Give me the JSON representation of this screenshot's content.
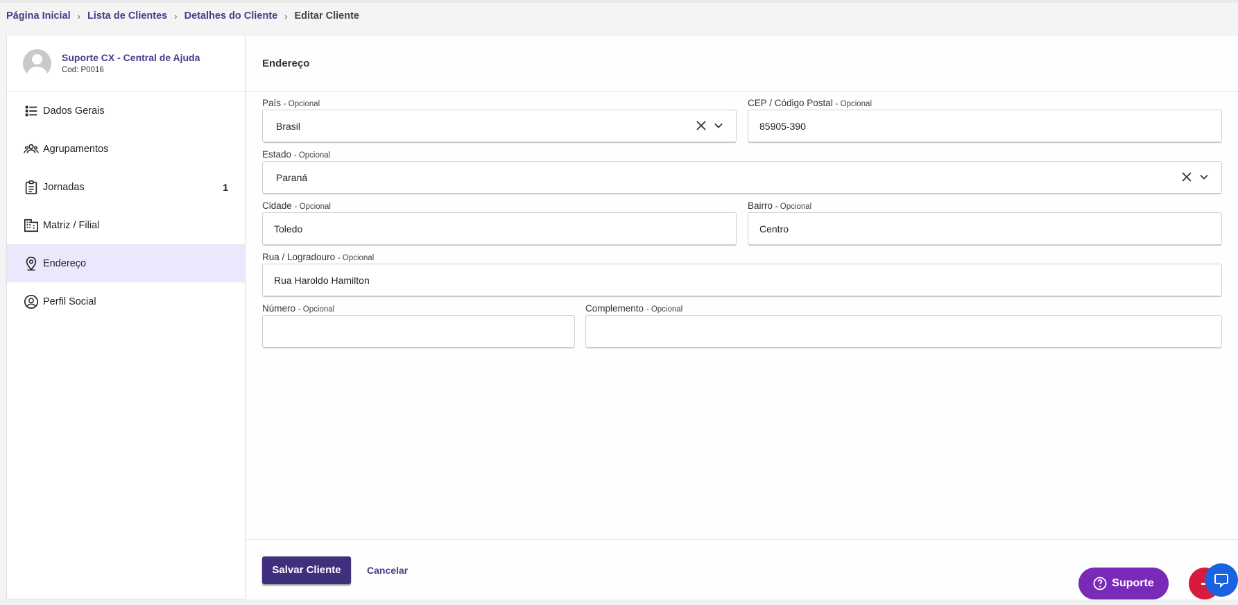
{
  "breadcrumb": {
    "items": [
      "Página Inicial",
      "Lista de Clientes",
      "Detalhes do Cliente"
    ],
    "current": "Editar Cliente"
  },
  "profile": {
    "name": "Suporte CX - Central de Ajuda",
    "code": "Cod: P0016"
  },
  "sidebar": {
    "items": [
      {
        "label": "Dados Gerais",
        "icon": "list-icon"
      },
      {
        "label": "Agrupamentos",
        "icon": "group-icon"
      },
      {
        "label": "Jornadas",
        "icon": "clipboard-icon",
        "count": "1"
      },
      {
        "label": "Matriz / Filial",
        "icon": "building-icon"
      },
      {
        "label": "Endereço",
        "icon": "location-pin-icon",
        "active": true
      },
      {
        "label": "Perfil Social",
        "icon": "account-circle-icon"
      }
    ]
  },
  "section": {
    "title": "Endereço"
  },
  "form": {
    "optional_suffix": "- Opcional",
    "pais": {
      "label": "País",
      "value": "Brasil"
    },
    "cep": {
      "label": "CEP / Código Postal",
      "value": "85905-390"
    },
    "estado": {
      "label": "Estado",
      "value": "Paraná"
    },
    "cidade": {
      "label": "Cidade",
      "value": "Toledo"
    },
    "bairro": {
      "label": "Bairro",
      "value": "Centro"
    },
    "rua": {
      "label": "Rua / Logradouro",
      "value": "Rua Haroldo Hamilton"
    },
    "numero": {
      "label": "Número",
      "value": ""
    },
    "complemento": {
      "label": "Complemento",
      "value": ""
    }
  },
  "footer": {
    "save_label": "Salvar Cliente",
    "cancel_label": "Cancelar"
  },
  "support": {
    "label": "Suporte"
  },
  "colors": {
    "primary": "#4a3a8c",
    "active_bg": "#ece7fd",
    "support": "#7a2ab8"
  }
}
